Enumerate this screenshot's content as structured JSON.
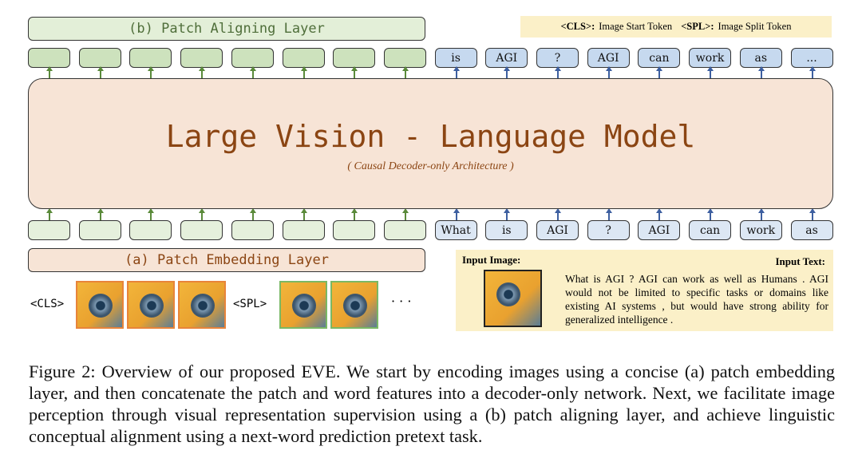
{
  "aligning_layer": "(b) Patch Aligning Layer",
  "embedding_layer": "(a) Patch Embedding Layer",
  "legend": {
    "cls": "<CLS>:",
    "cls_desc": "Image Start Token",
    "spl": "<SPL>:",
    "spl_desc": "Image Split Token"
  },
  "model": {
    "title": "Large Vision - Language Model",
    "subtitle": "( Causal Decoder-only Architecture )"
  },
  "output_tokens": [
    "is",
    "AGI",
    "?",
    "AGI",
    "can",
    "work",
    "as",
    "..."
  ],
  "input_tokens": [
    "What",
    "is",
    "AGI",
    "?",
    "AGI",
    "can",
    "work",
    "as"
  ],
  "image_row": {
    "cls": "<CLS>",
    "spl": "<SPL>",
    "ellipsis": "· · ·"
  },
  "input_panel": {
    "image_label": "Input Image:",
    "text_label": "Input Text:",
    "text": "What is AGI ? AGI can work as well as Humans . AGI would not be limited to specific tasks or domains like existing AI systems , but would have strong ability for generalized intelligence ."
  },
  "caption": "Figure 2: Overview of our proposed EVE. We start by encoding images using a concise (a) patch embedding layer, and then concatenate the patch and word features into a decoder-only network. Next, we facilitate image perception through visual representation supervision using a (b) patch aligning layer, and achieve linguistic conceptual alignment using a next-word prediction pretext task.",
  "colors": {
    "green_arrow": "#5a8a3a",
    "blue_arrow": "#3d5fa0",
    "model_text": "#8b4513",
    "model_fill": "#f7e4d6"
  }
}
